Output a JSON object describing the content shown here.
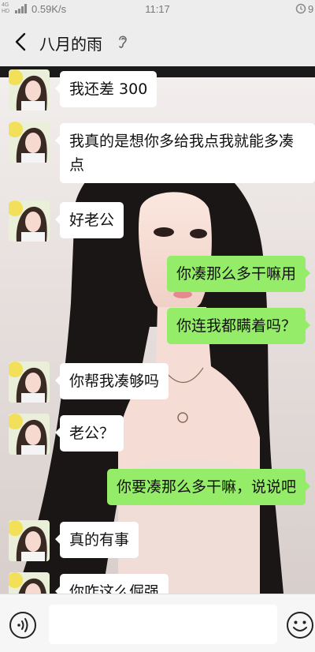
{
  "status_bar": {
    "network": "4G",
    "network_sub": "HD",
    "speed": "0.59K/s",
    "time": "11:17",
    "battery": "9"
  },
  "header": {
    "back_icon": "chevron-left-icon",
    "title": "八月的雨",
    "earpiece_icon": "ear-icon"
  },
  "messages": [
    {
      "side": "in",
      "text": "我还差 300"
    },
    {
      "side": "in",
      "text": "我真的是想你多给我点我就能多凑点"
    },
    {
      "side": "in",
      "text": "好老公"
    },
    {
      "side": "out",
      "text": "你凑那么多干嘛用"
    },
    {
      "side": "out",
      "text": "你连我都瞒着吗？"
    },
    {
      "side": "in",
      "text": "你帮我凑够吗"
    },
    {
      "side": "in",
      "text": "老公？"
    },
    {
      "side": "out",
      "text": "你要凑那么多干嘛，说说吧"
    },
    {
      "side": "in",
      "text": "真的有事"
    },
    {
      "side": "in",
      "text": "你咋这么倔强"
    }
  ],
  "input_bar": {
    "voice_icon": "voice-icon",
    "input_value": "",
    "emoji_icon": "emoji-icon"
  },
  "colors": {
    "outgoing_bubble": "#95ec69",
    "incoming_bubble": "#ffffff",
    "bar_background": "#ededed"
  }
}
